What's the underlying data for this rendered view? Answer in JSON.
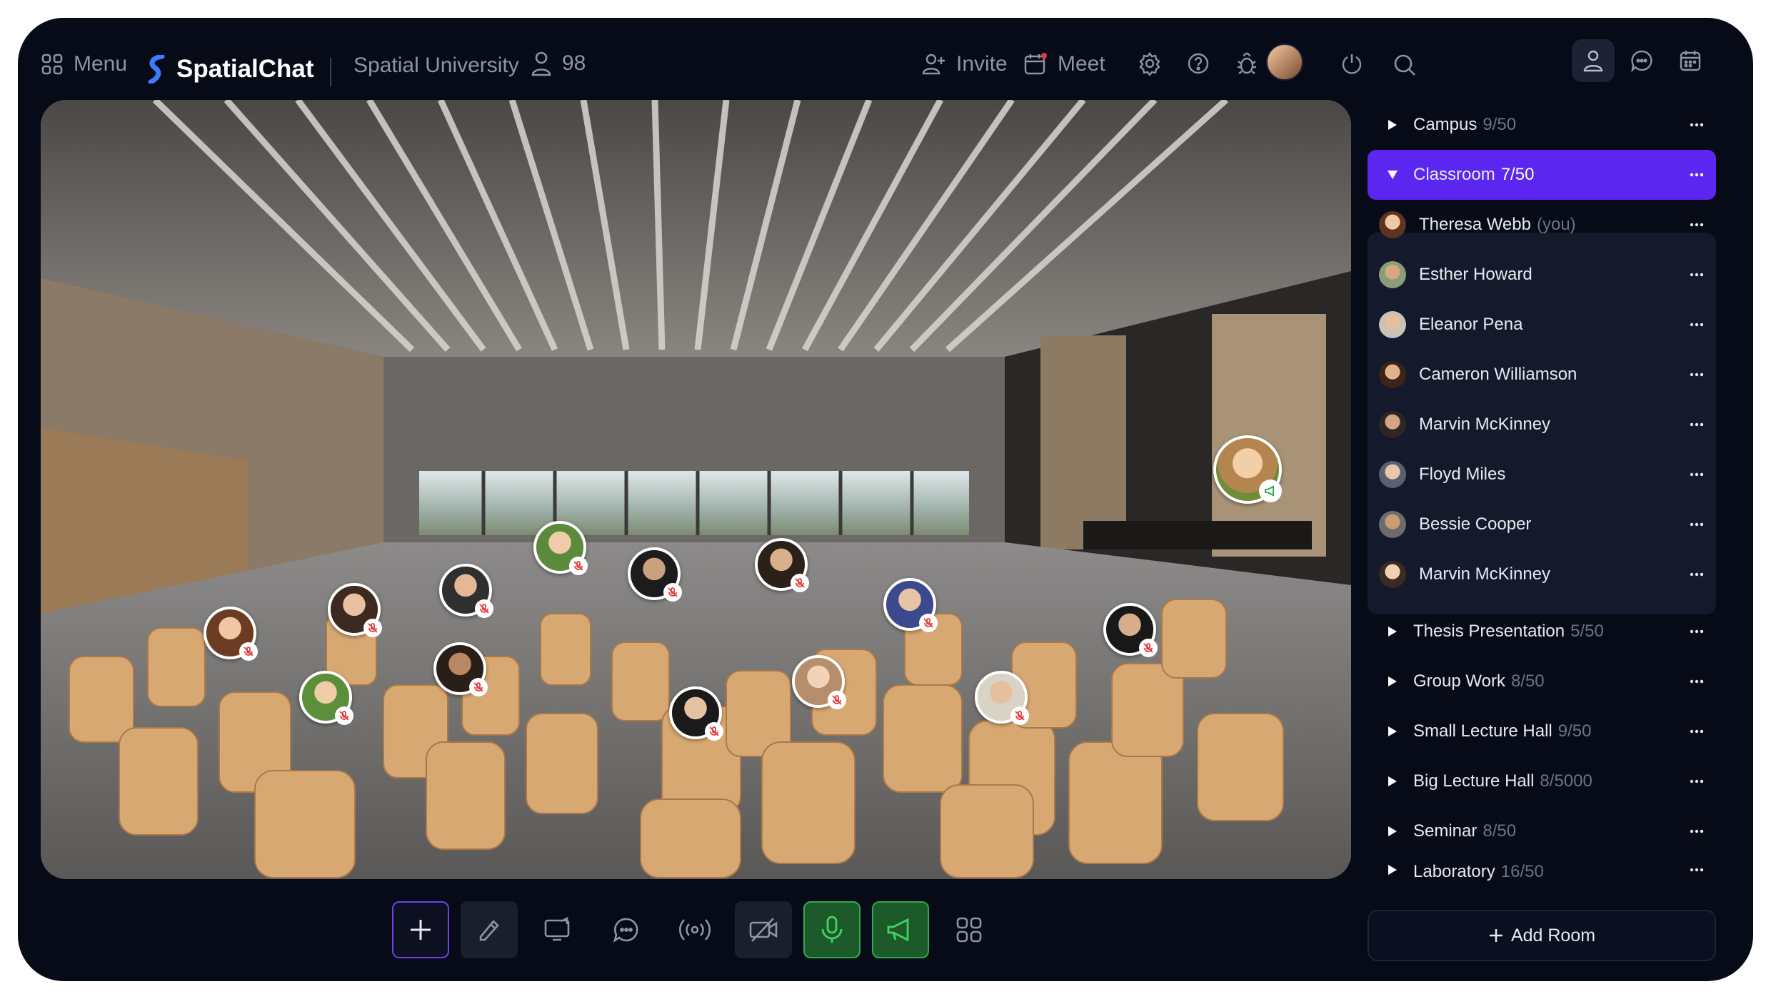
{
  "topbar": {
    "menu_label": "Menu",
    "logo_text": "SpatialChat",
    "space_name": "Spatial University",
    "participants_count": "98",
    "invite_label": "Invite",
    "meet_label": "Meet"
  },
  "rooms_top": [
    {
      "name": "Campus",
      "count": "9/50"
    },
    {
      "name": "Classroom",
      "count": "7/50",
      "active": true
    }
  ],
  "participants": [
    {
      "name": "Theresa Webb",
      "suffix": "(you)"
    },
    {
      "name": "Esther Howard",
      "suffix": ""
    },
    {
      "name": "Eleanor Pena",
      "suffix": ""
    },
    {
      "name": "Cameron Williamson",
      "suffix": ""
    },
    {
      "name": "Marvin McKinney",
      "suffix": ""
    },
    {
      "name": "Floyd Miles",
      "suffix": ""
    },
    {
      "name": "Bessie Cooper",
      "suffix": ""
    },
    {
      "name": "Marvin McKinney",
      "suffix": ""
    }
  ],
  "rooms_bottom": [
    {
      "name": "Thesis Presentation",
      "count": "5/50"
    },
    {
      "name": "Group Work",
      "count": "8/50"
    },
    {
      "name": "Small Lecture Hall",
      "count": "9/50"
    },
    {
      "name": "Big Lecture Hall",
      "count": "8/5000"
    },
    {
      "name": "Seminar",
      "count": "8/50"
    },
    {
      "name": "Laboratory",
      "count": "16/50"
    }
  ],
  "add_room_label": "Add Room",
  "colors": {
    "background": "#070b18",
    "accent": "#5b27f0",
    "mic_active": "#2fa94e",
    "muted": "#e23b3b"
  },
  "icons": {
    "menu": "grid-icon",
    "participants": "user-icon",
    "invite": "user-plus-icon",
    "meet": "calendar-icon",
    "settings": "gear-icon",
    "help": "help-icon",
    "bug": "bug-icon",
    "power": "power-icon",
    "search": "search-icon"
  }
}
